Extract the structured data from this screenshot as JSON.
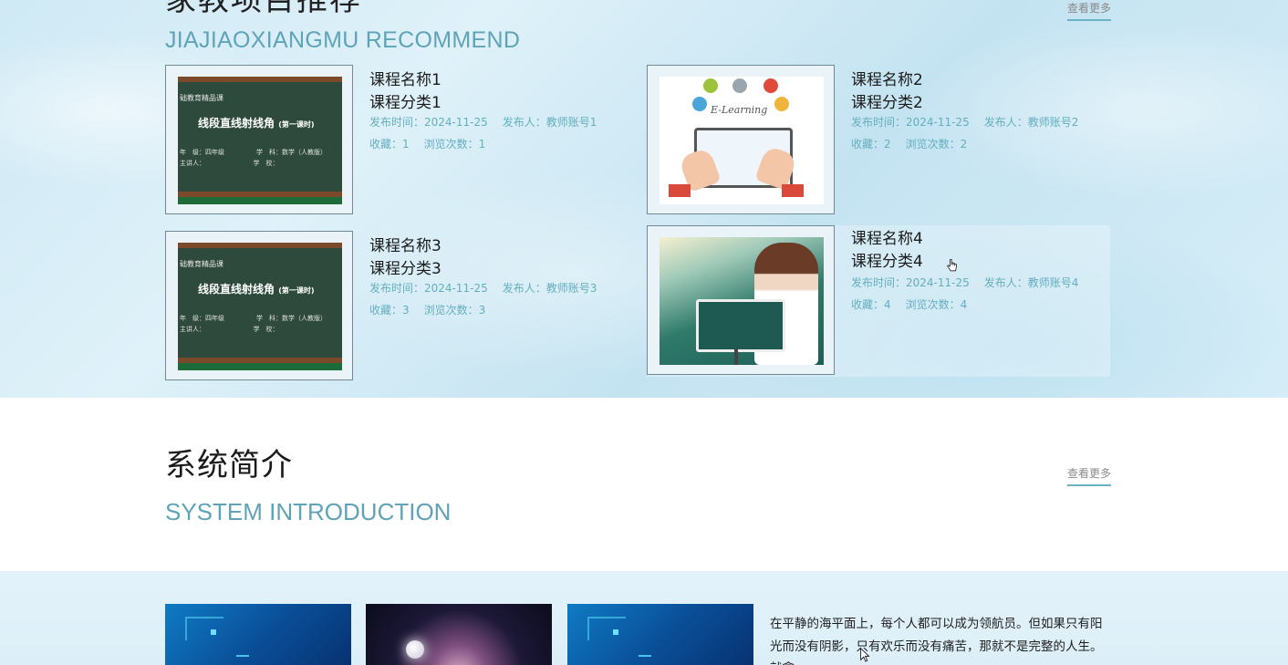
{
  "recommend": {
    "title_partial": "家教项目推荐",
    "subtitle": "JIAJIAOXIANGMU RECOMMEND",
    "more_label": "查看更多",
    "courses": [
      {
        "name": "课程名称1",
        "category": "课程分类1",
        "publish_time": "发布时间：2024-11-25",
        "publisher": "发布人：教师账号1",
        "favorites": "收藏：1",
        "views": "浏览次数：1",
        "thumb": "chalkboard"
      },
      {
        "name": "课程名称2",
        "category": "课程分类2",
        "publish_time": "发布时间：2024-11-25",
        "publisher": "发布人：教师账号2",
        "favorites": "收藏：2",
        "views": "浏览次数：2",
        "thumb": "e-learning"
      },
      {
        "name": "课程名称3",
        "category": "课程分类3",
        "publish_time": "发布时间：2024-11-25",
        "publisher": "发布人：教师账号3",
        "favorites": "收藏：3",
        "views": "浏览次数：3",
        "thumb": "chalkboard"
      },
      {
        "name": "课程名称4",
        "category": "课程分类4",
        "publish_time": "发布时间：2024-11-25",
        "publisher": "发布人：教师账号4",
        "favorites": "收藏：4",
        "views": "浏览次数：4",
        "thumb": "classroom"
      }
    ],
    "chalkboard": {
      "line1": "础教育精品课",
      "line2": "线段直线射线角",
      "line2_small": "(第一课时)",
      "line3": "年　级：四年级　　　　　学　科：数学（人教版）",
      "line4": "主讲人：　　　　　　　　学　校："
    },
    "elearning_word": "E-Learning"
  },
  "intro": {
    "title": "系统简介",
    "subtitle": "SYSTEM INTRODUCTION",
    "more_label": "查看更多",
    "text": "在平静的海平面上，每个人都可以成为领航员。但如果只有阳光而没有阴影，只有欢乐而没有痛苦，那就不是完整的人生。就拿"
  },
  "colors": {
    "accent": "#5fa3b8",
    "meta_text": "#64aebf",
    "thumb_border": "#6f8a95"
  }
}
